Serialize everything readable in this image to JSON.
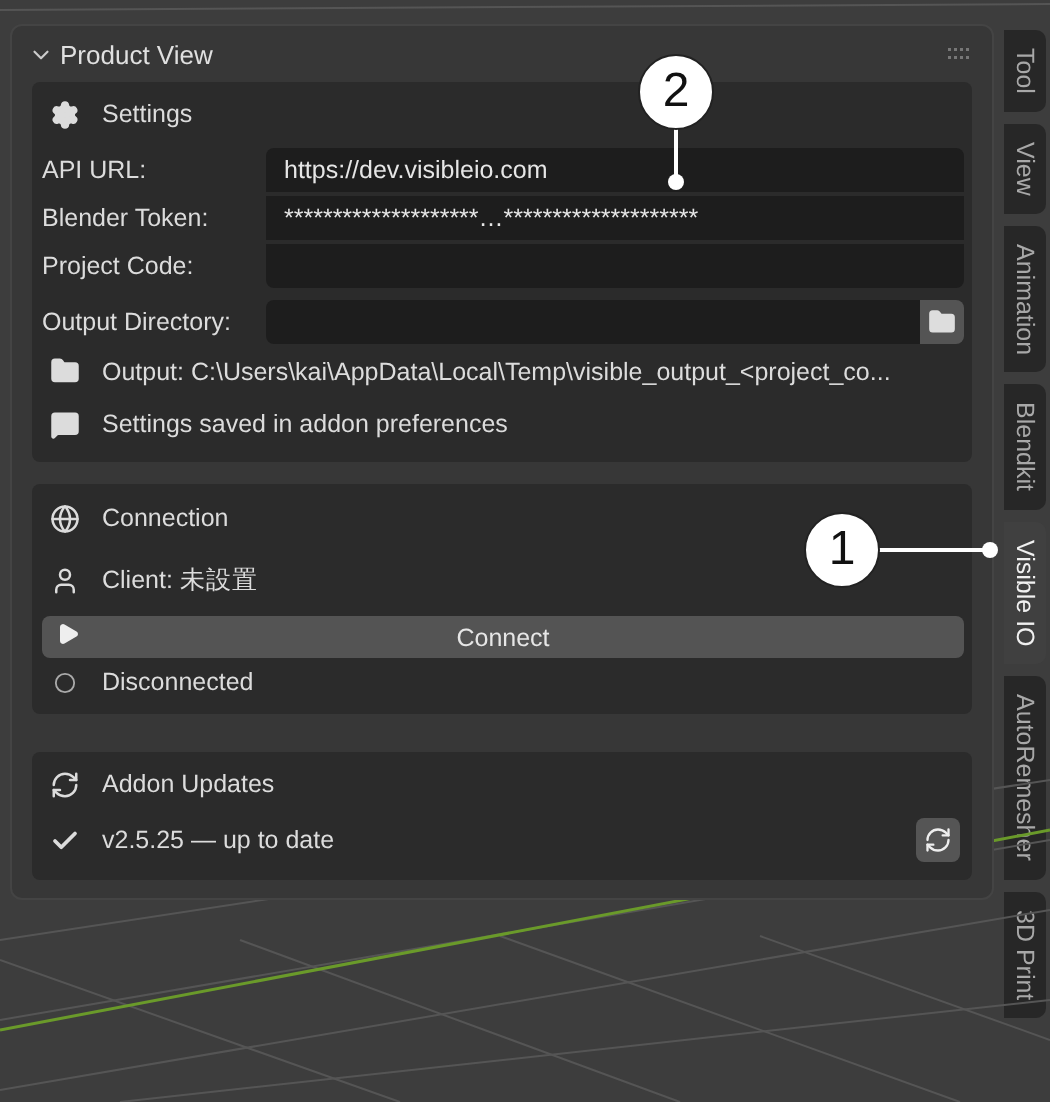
{
  "panel": {
    "title": "Product View",
    "expanded": true
  },
  "settings": {
    "title": "Settings",
    "fields": [
      {
        "label": "API URL:",
        "value": "https://dev.visibleio.com"
      },
      {
        "label": "Blender Token:",
        "value": "********************…********************"
      },
      {
        "label": "Project Code:"
      }
    ],
    "output_directory": {
      "label": "Output Directory:"
    },
    "output_path": "Output: C:\\Users\\kai\\AppData\\Local\\Temp\\visible_output_<project_co...",
    "info": "Settings saved in addon preferences"
  },
  "connection": {
    "title": "Connection",
    "client": "Client: 未設置",
    "button": "Connect",
    "status": "Disconnected"
  },
  "updates": {
    "title": "Addon Updates",
    "status": "v2.5.25 — up to date"
  },
  "tabs": [
    {
      "label": "Tool",
      "selected": false
    },
    {
      "label": "View",
      "selected": false
    },
    {
      "label": "Animation",
      "selected": false
    },
    {
      "label": "Blendkit",
      "selected": false
    },
    {
      "label": "Visible IO",
      "selected": true
    },
    {
      "label": "AutoRemesher",
      "selected": false
    },
    {
      "label": "3D Print",
      "selected": false
    }
  ],
  "callouts": [
    {
      "label": "2"
    },
    {
      "label": "1"
    }
  ]
}
